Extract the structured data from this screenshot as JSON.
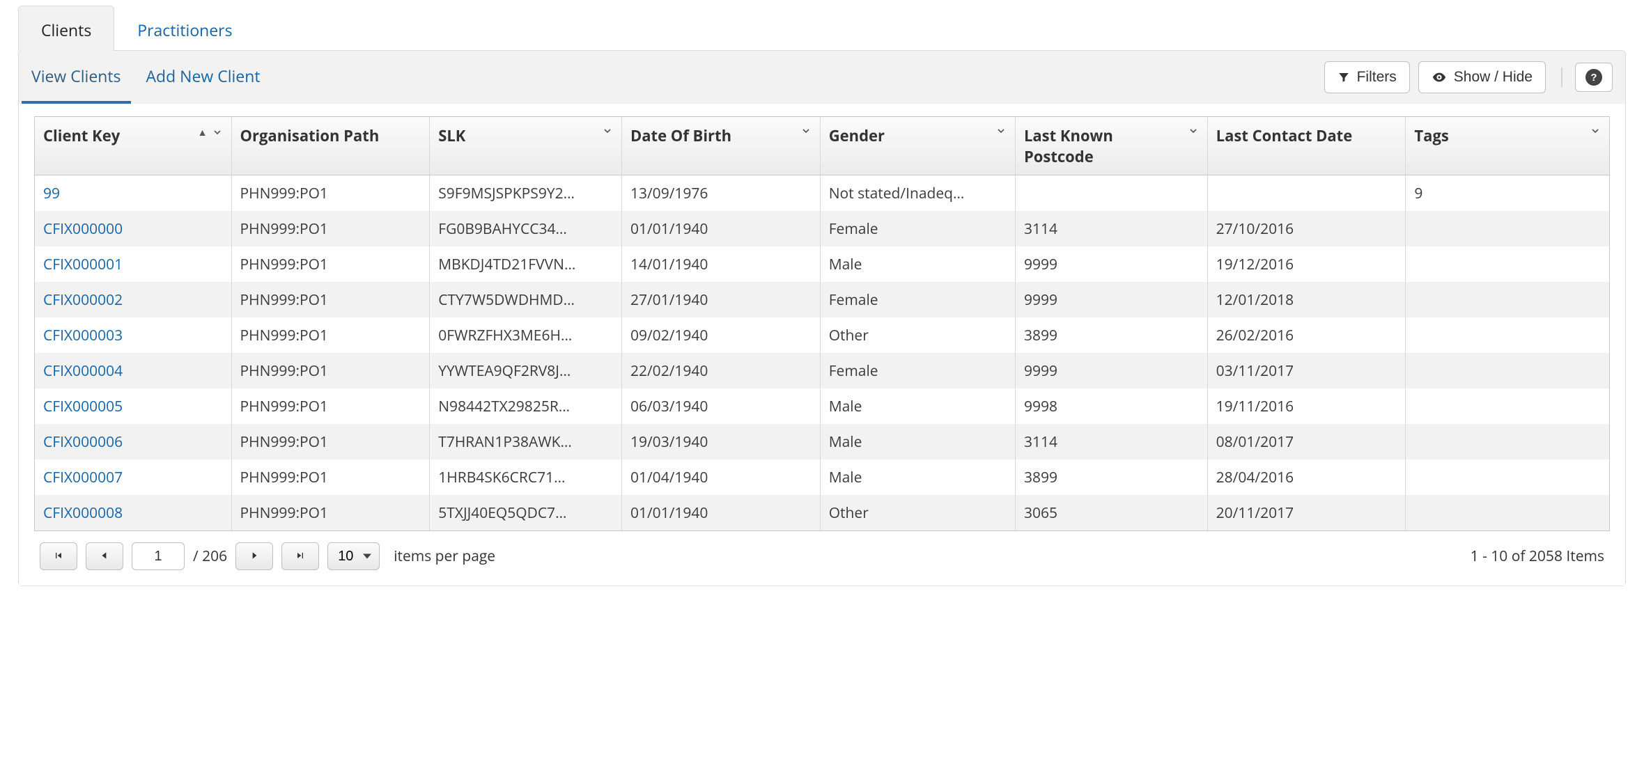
{
  "top_tabs": {
    "clients": "Clients",
    "practitioners": "Practitioners"
  },
  "sub_tabs": {
    "view_clients": "View Clients",
    "add_new_client": "Add New Client"
  },
  "toolbar": {
    "filters_label": "Filters",
    "show_hide_label": "Show / Hide",
    "help_label": "?"
  },
  "columns": {
    "client_key": "Client Key",
    "organisation_path": "Organisation Path",
    "slk": "SLK",
    "dob": "Date Of Birth",
    "gender": "Gender",
    "postcode": "Last Known Postcode",
    "last_contact": "Last Contact Date",
    "tags": "Tags"
  },
  "rows": [
    {
      "client_key": "99",
      "org_path": "PHN999:PO1",
      "slk": "S9F9MSJSPKPS9Y2…",
      "dob": "13/09/1976",
      "gender": "Not stated/Inadeq…",
      "postcode": "",
      "last_contact": "",
      "tags": "9"
    },
    {
      "client_key": "CFIX000000",
      "org_path": "PHN999:PO1",
      "slk": "FG0B9BAHYCC34…",
      "dob": "01/01/1940",
      "gender": "Female",
      "postcode": "3114",
      "last_contact": "27/10/2016",
      "tags": ""
    },
    {
      "client_key": "CFIX000001",
      "org_path": "PHN999:PO1",
      "slk": "MBKDJ4TD21FVVN…",
      "dob": "14/01/1940",
      "gender": "Male",
      "postcode": "9999",
      "last_contact": "19/12/2016",
      "tags": ""
    },
    {
      "client_key": "CFIX000002",
      "org_path": "PHN999:PO1",
      "slk": "CTY7W5DWDHMD…",
      "dob": "27/01/1940",
      "gender": "Female",
      "postcode": "9999",
      "last_contact": "12/01/2018",
      "tags": ""
    },
    {
      "client_key": "CFIX000003",
      "org_path": "PHN999:PO1",
      "slk": "0FWRZFHX3ME6H…",
      "dob": "09/02/1940",
      "gender": "Other",
      "postcode": "3899",
      "last_contact": "26/02/2016",
      "tags": ""
    },
    {
      "client_key": "CFIX000004",
      "org_path": "PHN999:PO1",
      "slk": "YYWTEA9QF2RV8J…",
      "dob": "22/02/1940",
      "gender": "Female",
      "postcode": "9999",
      "last_contact": "03/11/2017",
      "tags": ""
    },
    {
      "client_key": "CFIX000005",
      "org_path": "PHN999:PO1",
      "slk": "N98442TX29825R…",
      "dob": "06/03/1940",
      "gender": "Male",
      "postcode": "9998",
      "last_contact": "19/11/2016",
      "tags": ""
    },
    {
      "client_key": "CFIX000006",
      "org_path": "PHN999:PO1",
      "slk": "T7HRAN1P38AWK…",
      "dob": "19/03/1940",
      "gender": "Male",
      "postcode": "3114",
      "last_contact": "08/01/2017",
      "tags": ""
    },
    {
      "client_key": "CFIX000007",
      "org_path": "PHN999:PO1",
      "slk": "1HRB4SK6CRC71…",
      "dob": "01/04/1940",
      "gender": "Male",
      "postcode": "3899",
      "last_contact": "28/04/2016",
      "tags": ""
    },
    {
      "client_key": "CFIX000008",
      "org_path": "PHN999:PO1",
      "slk": "5TXJJ40EQ5QDC7…",
      "dob": "01/01/1940",
      "gender": "Other",
      "postcode": "3065",
      "last_contact": "20/11/2017",
      "tags": ""
    }
  ],
  "pager": {
    "page": "1",
    "total_pages_label": "/ 206",
    "page_size": "10",
    "items_per_page_label": "items per page",
    "range_label": "1 - 10 of 2058 Items"
  }
}
